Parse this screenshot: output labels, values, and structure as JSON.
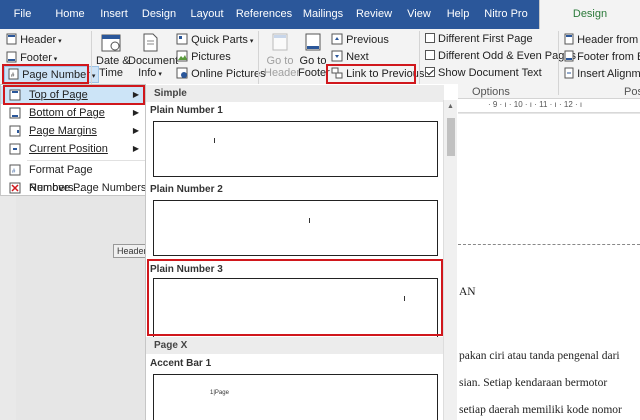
{
  "tabs": [
    "File",
    "Home",
    "Insert",
    "Design",
    "Layout",
    "References",
    "Mailings",
    "Review",
    "View",
    "Help",
    "Nitro Pro",
    "Design"
  ],
  "ribbon": {
    "header": "Header",
    "footer": "Footer",
    "page_number": "Page Number",
    "date_time_1": "Date &",
    "date_time_2": "Time",
    "document_info_1": "Document",
    "document_info_2": "Info",
    "quick_parts": "Quick Parts",
    "pictures": "Pictures",
    "online_pictures": "Online Pictures",
    "goto_header_1": "Go to",
    "goto_header_2": "Header",
    "goto_footer_1": "Go to",
    "goto_footer_2": "Footer",
    "previous": "Previous",
    "next": "Next",
    "link_to_previous": "Link to Previous",
    "different_first_page": "Different First Page",
    "different_odd_even": "Different Odd & Even Pages",
    "show_document_text": "Show Document Text",
    "options_group": "Options",
    "header_from_top": "Header from To",
    "footer_from_bottom": "Footer from Bo",
    "insert_alignment": "Insert Alignmer",
    "position_group": "Posi"
  },
  "menu": {
    "items": [
      {
        "label": "Top of Page",
        "icon": "page-top-icon",
        "submenu": true
      },
      {
        "label": "Bottom of Page",
        "icon": "page-bottom-icon",
        "submenu": true
      },
      {
        "label": "Page Margins",
        "icon": "page-margins-icon",
        "submenu": true
      },
      {
        "label": "Current Position",
        "icon": "current-position-icon",
        "submenu": true
      },
      {
        "label": "Format Page Numbers...",
        "icon": "format-page-numbers-icon",
        "submenu": false
      },
      {
        "label": "Remove Page Numbers",
        "icon": "remove-page-numbers-icon",
        "submenu": false
      }
    ]
  },
  "gallery": {
    "section_simple": "Simple",
    "plain1": "Plain Number 1",
    "plain2": "Plain Number 2",
    "plain3": "Plain Number 3",
    "section_page_x": "Page X",
    "accent1": "Accent Bar 1",
    "accent_sample": "1|Page"
  },
  "document": {
    "header_tag": "Header",
    "line1": "AN",
    "line2": "pakan ciri atau tanda pengenal dari",
    "line3": "sian.  Setiap  kendaraan  bermotor",
    "line4": "setiap daerah memiliki kode nomor"
  },
  "colors": {
    "ribbon_blue": "#2b579a",
    "highlight": "#d0171c",
    "menu_hover": "#cce4f7"
  }
}
